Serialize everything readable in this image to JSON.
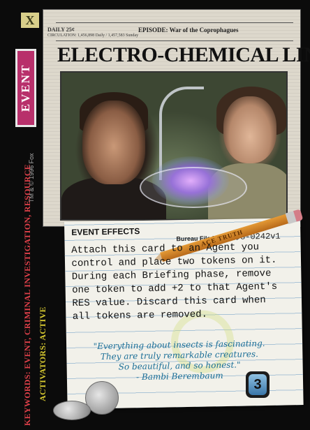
{
  "card": {
    "set_symbol": "X",
    "type": "EVENT",
    "keywords": "KEYWORDS: EVENT, CRIMINAL INVESTIGATION, RESOURCE",
    "activators": "ACTIVATORS: ACTIVE",
    "copyright": "TM & © 1996 Fox",
    "newspaper": {
      "daily": "DAILY 25¢",
      "circulation": "CIRCULATION: 1,456,898 Daily / 1,457,583 Sunday",
      "episode": "EPISODE: War of the Coprophagues",
      "headline": "ELECTRO-CHEMICAL LINK"
    },
    "section_header": "EVENT EFFECTS",
    "bureau_file_label": "Bureau File Number:",
    "bureau_file_number": "XF08-0242v1",
    "pencil_brand": "ACE TRUTH",
    "effect_lines": [
      "Attach this card to an Agent you",
      "control and place two tokens on it.",
      "During each Briefing phase, remove",
      "one token to add +2 to that Agent's",
      "RES value. Discard this card when",
      "all tokens are removed."
    ],
    "quote_lines": [
      "\"Everything about insects is fascinating.",
      "They are truly remarkable creatures.",
      "So beautiful, and so honest.\"",
      "- Bambi Berembaum"
    ],
    "cost": "3"
  }
}
